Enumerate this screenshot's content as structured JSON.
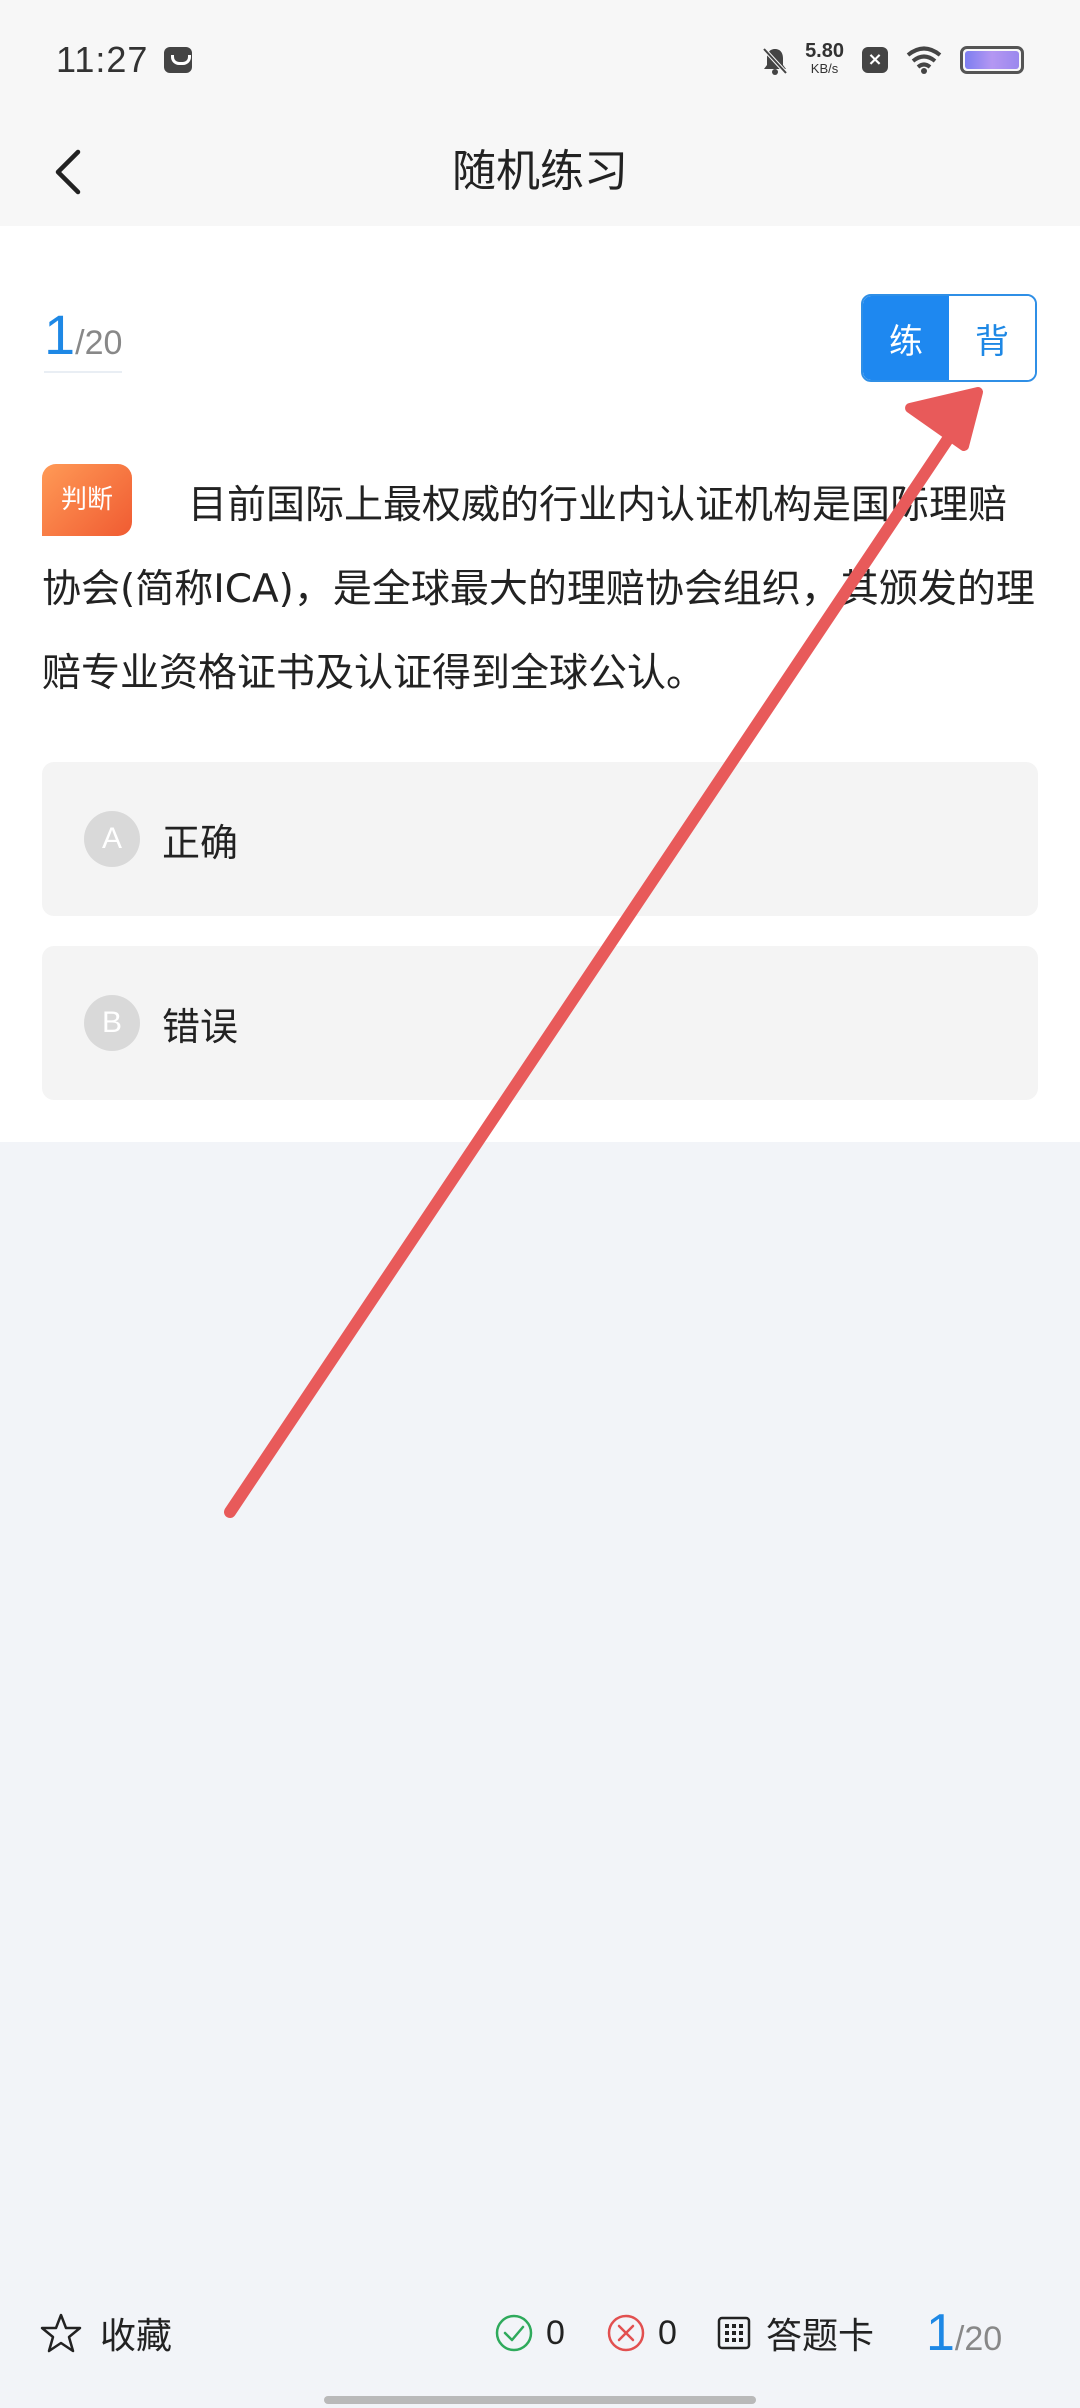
{
  "status_bar": {
    "time": "11:27",
    "net_speed_value": "5.80",
    "net_speed_unit": "KB/s"
  },
  "nav": {
    "title": "随机练习"
  },
  "progress": {
    "current": "1",
    "total": "/20"
  },
  "mode_toggle": {
    "practice_label": "练",
    "memorize_label": "背",
    "selected": "练"
  },
  "question": {
    "type_tag": "判断",
    "text": "目前国际上最权威的行业内认证机构是国际理赔协会(简称ICA)，是全球最大的理赔协会组织，其颁发的理赔专业资格证书及认证得到全球公认。"
  },
  "options": [
    {
      "letter": "A",
      "text": "正确"
    },
    {
      "letter": "B",
      "text": "错误"
    }
  ],
  "bottom_bar": {
    "favorite_label": "收藏",
    "correct_count": "0",
    "wrong_count": "0",
    "answer_card_label": "答题卡",
    "progress_current": "1",
    "progress_total": "/20"
  },
  "colors": {
    "accent_blue": "#1e88f0",
    "tag_orange": "#f05b32",
    "annotation_red": "#e85a5a"
  }
}
